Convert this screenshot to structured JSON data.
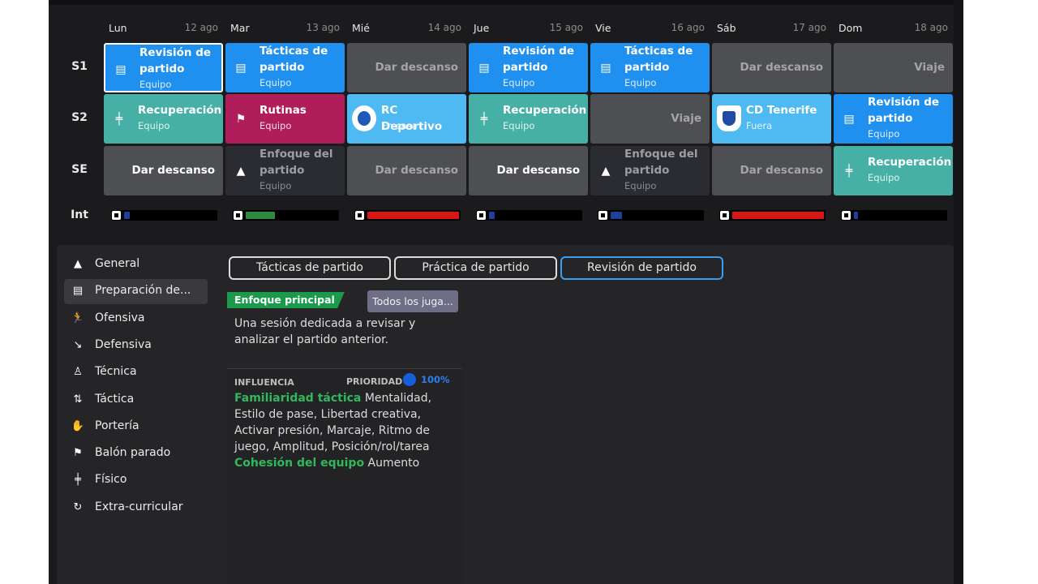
{
  "days": [
    {
      "name": "Lun",
      "date": "12 ago"
    },
    {
      "name": "Mar",
      "date": "13 ago"
    },
    {
      "name": "Mié",
      "date": "14 ago"
    },
    {
      "name": "Jue",
      "date": "15 ago"
    },
    {
      "name": "Vie",
      "date": "16 ago"
    },
    {
      "name": "Sáb",
      "date": "17 ago"
    },
    {
      "name": "Dom",
      "date": "18 ago"
    }
  ],
  "rows": [
    "S1",
    "S2",
    "SE",
    "Int"
  ],
  "sessions": {
    "s1": [
      {
        "title": "Revisión de partido",
        "sub": "Equipo",
        "color": "blue",
        "icon": "clipboard-icon"
      },
      {
        "title": "Tácticas de partido",
        "sub": "Equipo",
        "color": "blue",
        "icon": "clipboard-icon"
      },
      {
        "title": "Dar descanso",
        "color": "grey"
      },
      {
        "title": "Revisión de partido",
        "sub": "Equipo",
        "color": "blue",
        "icon": "clipboard-icon"
      },
      {
        "title": "Tácticas de partido",
        "sub": "Equipo",
        "color": "blue",
        "icon": "clipboard-icon"
      },
      {
        "title": "Dar descanso",
        "color": "grey"
      },
      {
        "title": "Viaje",
        "color": "grey"
      }
    ],
    "s2": [
      {
        "title": "Recuperación",
        "sub": "Equipo",
        "color": "teal",
        "icon": "dumbbell-icon"
      },
      {
        "title": "Rutinas",
        "sub": "Equipo",
        "color": "magenta",
        "icon": "set-piece-icon"
      },
      {
        "title": "RC Deportivo",
        "sub": "En casa",
        "color": "lightblue",
        "icon": "rc-deportivo-crest-icon"
      },
      {
        "title": "Recuperación",
        "sub": "Equipo",
        "color": "teal",
        "icon": "dumbbell-icon"
      },
      {
        "title": "Viaje",
        "color": "grey"
      },
      {
        "title": "CD Tenerife",
        "sub": "Fuera",
        "color": "lightblue",
        "icon": "cd-tenerife-crest-icon"
      },
      {
        "title": "Revisión de partido",
        "sub": "Equipo",
        "color": "blue",
        "icon": "clipboard-icon"
      }
    ],
    "se": [
      {
        "title": "Dar descanso",
        "color": "grey"
      },
      {
        "title": "Enfoque del partido",
        "sub": "Equipo",
        "color": "dark",
        "icon": "cone-icon"
      },
      {
        "title": "Dar descanso",
        "color": "grey"
      },
      {
        "title": "Dar descanso",
        "color": "grey"
      },
      {
        "title": "Enfoque del partido",
        "sub": "Equipo",
        "color": "dark",
        "icon": "cone-icon"
      },
      {
        "title": "Dar descanso",
        "color": "grey"
      },
      {
        "title": "Recuperación",
        "sub": "Equipo",
        "color": "teal",
        "icon": "dumbbell-icon"
      }
    ]
  },
  "intensity": [
    {
      "level": 0.06,
      "color": "#1e3f9a"
    },
    {
      "level": 0.32,
      "color": "#2d8a3e"
    },
    {
      "level": 1.0,
      "color": "#d81616"
    },
    {
      "level": 0.06,
      "color": "#1e3f9a"
    },
    {
      "level": 0.12,
      "color": "#1e3f9a"
    },
    {
      "level": 1.0,
      "color": "#d81616"
    },
    {
      "level": 0.04,
      "color": "#1e3f9a"
    }
  ],
  "sidebar": {
    "items": [
      {
        "label": "General",
        "icon": "cone-icon"
      },
      {
        "label": "Preparación de...",
        "icon": "clipboard-icon"
      },
      {
        "label": "Ofensiva",
        "icon": "running-player-icon"
      },
      {
        "label": "Defensiva",
        "icon": "sliding-tackle-icon"
      },
      {
        "label": "Técnica",
        "icon": "dribbling-player-icon"
      },
      {
        "label": "Táctica",
        "icon": "tactics-arrows-icon"
      },
      {
        "label": "Portería",
        "icon": "goalkeeper-icon"
      },
      {
        "label": "Balón parado",
        "icon": "set-piece-icon"
      },
      {
        "label": "Físico",
        "icon": "dumbbell-icon"
      },
      {
        "label": "Extra-curricular",
        "icon": "refresh-icon"
      }
    ],
    "active": 1
  },
  "tabs": [
    "Tácticas de partido",
    "Práctica de partido",
    "Revisión de partido"
  ],
  "active_tab": 2,
  "detail": {
    "focus_label": "Enfoque principal",
    "players_button": "Todos los juga...",
    "description": "Una sesión dedicada a revisar y analizar el partido anterior.",
    "influence_label": "INFLUENCIA",
    "priority_label": "PRIORIDAD",
    "priority_value": "100%",
    "influences": [
      {
        "name": "Familiaridad táctica",
        "value": "Mentalidad, Estilo de pase, Libertad creativa, Activar presión, Marcaje, Ritmo de juego, Amplitud, Posición/rol/tarea"
      },
      {
        "name": "Cohesión del equipo",
        "value": "Aumento"
      }
    ]
  },
  "colors": {
    "accent": "#3a9ef0",
    "focus_badge": "#1c9a4c",
    "influence_green": "#2fb85c"
  }
}
